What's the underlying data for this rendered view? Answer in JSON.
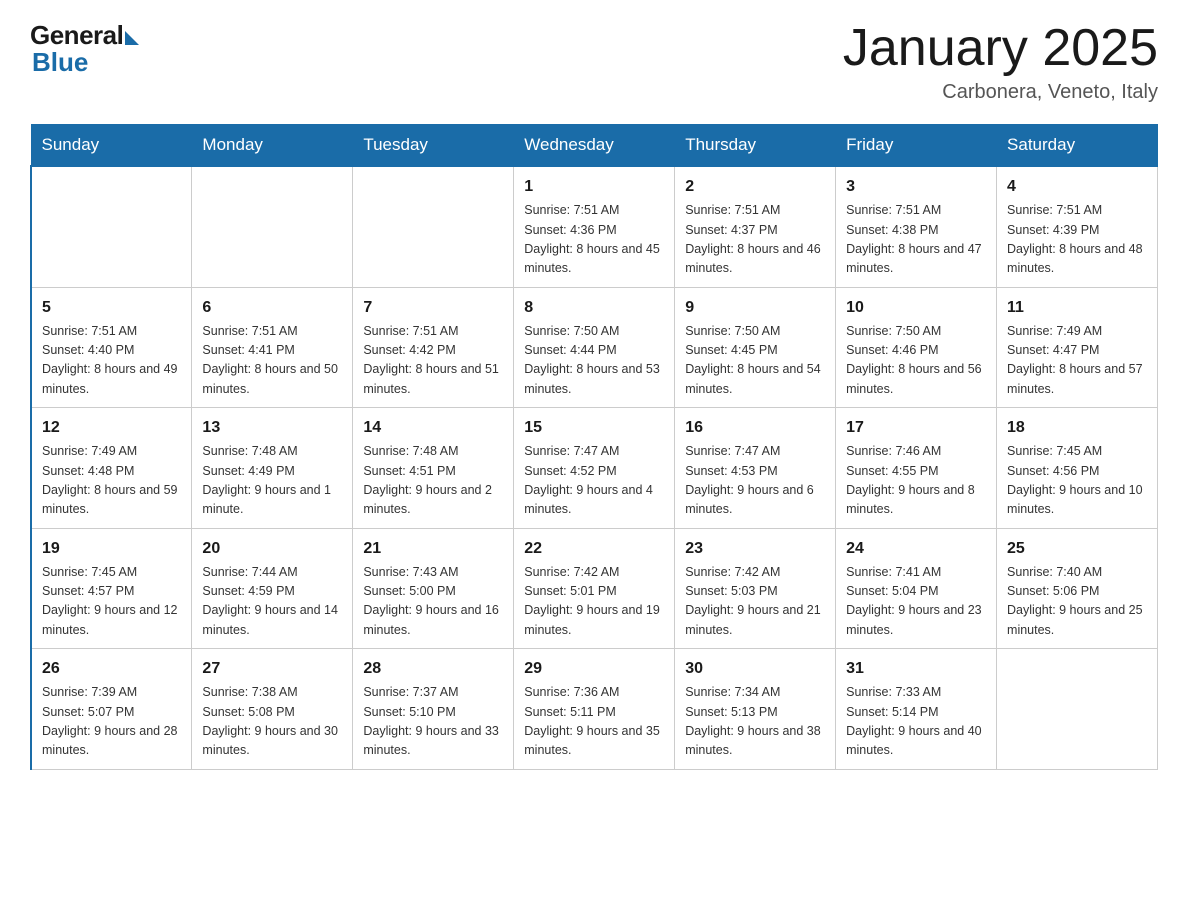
{
  "logo": {
    "general": "General",
    "blue": "Blue"
  },
  "header": {
    "title": "January 2025",
    "subtitle": "Carbonera, Veneto, Italy"
  },
  "days_of_week": [
    "Sunday",
    "Monday",
    "Tuesday",
    "Wednesday",
    "Thursday",
    "Friday",
    "Saturday"
  ],
  "weeks": [
    [
      {
        "day": "",
        "info": ""
      },
      {
        "day": "",
        "info": ""
      },
      {
        "day": "",
        "info": ""
      },
      {
        "day": "1",
        "info": "Sunrise: 7:51 AM\nSunset: 4:36 PM\nDaylight: 8 hours\nand 45 minutes."
      },
      {
        "day": "2",
        "info": "Sunrise: 7:51 AM\nSunset: 4:37 PM\nDaylight: 8 hours\nand 46 minutes."
      },
      {
        "day": "3",
        "info": "Sunrise: 7:51 AM\nSunset: 4:38 PM\nDaylight: 8 hours\nand 47 minutes."
      },
      {
        "day": "4",
        "info": "Sunrise: 7:51 AM\nSunset: 4:39 PM\nDaylight: 8 hours\nand 48 minutes."
      }
    ],
    [
      {
        "day": "5",
        "info": "Sunrise: 7:51 AM\nSunset: 4:40 PM\nDaylight: 8 hours\nand 49 minutes."
      },
      {
        "day": "6",
        "info": "Sunrise: 7:51 AM\nSunset: 4:41 PM\nDaylight: 8 hours\nand 50 minutes."
      },
      {
        "day": "7",
        "info": "Sunrise: 7:51 AM\nSunset: 4:42 PM\nDaylight: 8 hours\nand 51 minutes."
      },
      {
        "day": "8",
        "info": "Sunrise: 7:50 AM\nSunset: 4:44 PM\nDaylight: 8 hours\nand 53 minutes."
      },
      {
        "day": "9",
        "info": "Sunrise: 7:50 AM\nSunset: 4:45 PM\nDaylight: 8 hours\nand 54 minutes."
      },
      {
        "day": "10",
        "info": "Sunrise: 7:50 AM\nSunset: 4:46 PM\nDaylight: 8 hours\nand 56 minutes."
      },
      {
        "day": "11",
        "info": "Sunrise: 7:49 AM\nSunset: 4:47 PM\nDaylight: 8 hours\nand 57 minutes."
      }
    ],
    [
      {
        "day": "12",
        "info": "Sunrise: 7:49 AM\nSunset: 4:48 PM\nDaylight: 8 hours\nand 59 minutes."
      },
      {
        "day": "13",
        "info": "Sunrise: 7:48 AM\nSunset: 4:49 PM\nDaylight: 9 hours\nand 1 minute."
      },
      {
        "day": "14",
        "info": "Sunrise: 7:48 AM\nSunset: 4:51 PM\nDaylight: 9 hours\nand 2 minutes."
      },
      {
        "day": "15",
        "info": "Sunrise: 7:47 AM\nSunset: 4:52 PM\nDaylight: 9 hours\nand 4 minutes."
      },
      {
        "day": "16",
        "info": "Sunrise: 7:47 AM\nSunset: 4:53 PM\nDaylight: 9 hours\nand 6 minutes."
      },
      {
        "day": "17",
        "info": "Sunrise: 7:46 AM\nSunset: 4:55 PM\nDaylight: 9 hours\nand 8 minutes."
      },
      {
        "day": "18",
        "info": "Sunrise: 7:45 AM\nSunset: 4:56 PM\nDaylight: 9 hours\nand 10 minutes."
      }
    ],
    [
      {
        "day": "19",
        "info": "Sunrise: 7:45 AM\nSunset: 4:57 PM\nDaylight: 9 hours\nand 12 minutes."
      },
      {
        "day": "20",
        "info": "Sunrise: 7:44 AM\nSunset: 4:59 PM\nDaylight: 9 hours\nand 14 minutes."
      },
      {
        "day": "21",
        "info": "Sunrise: 7:43 AM\nSunset: 5:00 PM\nDaylight: 9 hours\nand 16 minutes."
      },
      {
        "day": "22",
        "info": "Sunrise: 7:42 AM\nSunset: 5:01 PM\nDaylight: 9 hours\nand 19 minutes."
      },
      {
        "day": "23",
        "info": "Sunrise: 7:42 AM\nSunset: 5:03 PM\nDaylight: 9 hours\nand 21 minutes."
      },
      {
        "day": "24",
        "info": "Sunrise: 7:41 AM\nSunset: 5:04 PM\nDaylight: 9 hours\nand 23 minutes."
      },
      {
        "day": "25",
        "info": "Sunrise: 7:40 AM\nSunset: 5:06 PM\nDaylight: 9 hours\nand 25 minutes."
      }
    ],
    [
      {
        "day": "26",
        "info": "Sunrise: 7:39 AM\nSunset: 5:07 PM\nDaylight: 9 hours\nand 28 minutes."
      },
      {
        "day": "27",
        "info": "Sunrise: 7:38 AM\nSunset: 5:08 PM\nDaylight: 9 hours\nand 30 minutes."
      },
      {
        "day": "28",
        "info": "Sunrise: 7:37 AM\nSunset: 5:10 PM\nDaylight: 9 hours\nand 33 minutes."
      },
      {
        "day": "29",
        "info": "Sunrise: 7:36 AM\nSunset: 5:11 PM\nDaylight: 9 hours\nand 35 minutes."
      },
      {
        "day": "30",
        "info": "Sunrise: 7:34 AM\nSunset: 5:13 PM\nDaylight: 9 hours\nand 38 minutes."
      },
      {
        "day": "31",
        "info": "Sunrise: 7:33 AM\nSunset: 5:14 PM\nDaylight: 9 hours\nand 40 minutes."
      },
      {
        "day": "",
        "info": ""
      }
    ]
  ]
}
